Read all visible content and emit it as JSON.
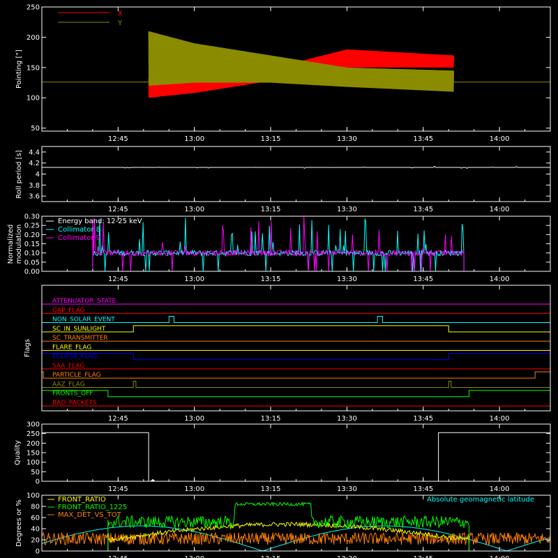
{
  "time_ticks": [
    "12:45",
    "13:00",
    "13:15",
    "13:30",
    "13:45",
    "14:00"
  ],
  "chart_data": [
    {
      "type": "line",
      "id": "pointing",
      "ylabel": "Pointing [\"]",
      "ylim": [
        45,
        250
      ],
      "yticks": [
        50,
        100,
        150,
        200,
        250
      ],
      "legend_position": "top-left",
      "series": [
        {
          "name": "X",
          "color": "#ff0000",
          "envelope": {
            "x": [
              "12:51",
              "13:00",
              "13:15",
              "13:30",
              "13:51"
            ],
            "upper": [
              133,
              138,
              148,
              180,
              170
            ],
            "lower": [
              100,
              108,
              128,
              150,
              150
            ]
          }
        },
        {
          "name": "Y",
          "color": "#8b8b00",
          "envelope": {
            "x": [
              "12:51",
              "13:00",
              "13:15",
              "13:30",
              "13:51"
            ],
            "upper": [
              210,
              190,
              170,
              150,
              145
            ],
            "lower": [
              120,
              125,
              125,
              118,
              110
            ]
          }
        }
      ],
      "baseline": {
        "color": "#8b8b00",
        "y": 126
      },
      "active_range": [
        "12:51",
        "13:51"
      ]
    },
    {
      "type": "line",
      "id": "roll-period",
      "ylabel": "Roll period [s]",
      "ylim": [
        3.5,
        4.5
      ],
      "yticks": [
        3.6,
        3.8,
        4.0,
        4.2,
        4.4
      ],
      "series": [
        {
          "color": "#ffffff",
          "value": 4.12
        }
      ]
    },
    {
      "type": "line",
      "id": "modulation",
      "ylabel": "Normalized\nmodulation",
      "ylim": [
        0,
        0.3
      ],
      "yticks": [
        0.0,
        0.05,
        0.1,
        0.15,
        0.2,
        0.25,
        0.3
      ],
      "ytick_labels": [
        "0.00",
        "0.05",
        "0.10",
        "0.15",
        "0.20",
        "0.25",
        "0.30"
      ],
      "annotation": "Energy band: 12-25 keV",
      "series": [
        {
          "name": "Collimator 8",
          "color": "#00ffff",
          "level": 0.1,
          "range": [
            "12:40",
            "13:53"
          ]
        },
        {
          "name": "Collimator 9",
          "color": "#ff00ff",
          "level": 0.1,
          "range": [
            "12:40",
            "13:53"
          ]
        }
      ]
    },
    {
      "type": "flags",
      "id": "flags",
      "ylabel": "Flags",
      "flags": [
        {
          "name": "ATTENUATOR_STATE",
          "color": "#ff00ff",
          "pulses": []
        },
        {
          "name": "GAP_FLAG",
          "color": "#ff0000",
          "pulses": []
        },
        {
          "name": "NON_SOLAR_EVENT",
          "color": "#00ffff",
          "pulses": [
            [
              "12:55",
              "12:56"
            ],
            [
              "13:36",
              "13:37"
            ]
          ]
        },
        {
          "name": "SC_IN_SUNLIGHT",
          "color": "#ffff00",
          "pulses": [
            [
              "12:48",
              "13:50"
            ]
          ]
        },
        {
          "name": "SC_TRANSMITTER",
          "color": "#ff8000",
          "pulses": []
        },
        {
          "name": "FLARE_FLAG",
          "color": "#ffff00",
          "pulses": []
        },
        {
          "name": "ECLIPSE_FLAG",
          "color": "#0000ff",
          "pulses": [
            [
              "12:30",
              "12:48"
            ],
            [
              "13:50",
              "14:10"
            ]
          ]
        },
        {
          "name": "SAA_FLAG",
          "color": "#ff0000",
          "pulses": []
        },
        {
          "name": "PARTICLE_FLAG",
          "color": "#ff8000",
          "pulses": [
            [
              "12:30",
              "12:30.3"
            ],
            [
              "14:07",
              "14:10"
            ]
          ]
        },
        {
          "name": "AAZ_FLAG",
          "color": "#8b8b00",
          "pulses": [
            [
              "12:48",
              "12:48.5"
            ],
            [
              "13:50",
              "13:50.5"
            ]
          ]
        },
        {
          "name": "FRONTS_OFF",
          "color": "#00ff00",
          "pulses": [
            [
              "12:30",
              "12:43"
            ],
            [
              "13:54",
              "14:10"
            ]
          ]
        },
        {
          "name": "BAD_PACKETS",
          "color": "#ff0000",
          "pulses": []
        }
      ]
    },
    {
      "type": "line",
      "id": "quality",
      "ylabel": "Quality",
      "ylim": [
        0,
        300
      ],
      "yticks": [
        0,
        50,
        100,
        150,
        200,
        250,
        300
      ],
      "series": [
        {
          "color": "#ffffff",
          "segments": [
            [
              [
                "12:30",
                255
              ],
              [
                "12:51",
                255
              ],
              [
                "12:51",
                0
              ],
              [
                "13:48",
                0
              ],
              [
                "13:48",
                255
              ],
              [
                "14:10",
                255
              ]
            ]
          ]
        }
      ]
    },
    {
      "type": "line",
      "id": "ratios",
      "ylabel": "Degrees or %",
      "ylim": [
        0,
        100
      ],
      "yticks": [
        0,
        20,
        40,
        60,
        80,
        100
      ],
      "series": [
        {
          "name": "FRONT_RATIO",
          "color": "#ffff00"
        },
        {
          "name": "FRONT_RATIO_1225",
          "color": "#00ff00"
        },
        {
          "name": "MAX_DET_VS_TOT",
          "color": "#ff8000"
        },
        {
          "name": "Absolute geomagnetic latitude",
          "color": "#00ffff"
        }
      ]
    }
  ]
}
